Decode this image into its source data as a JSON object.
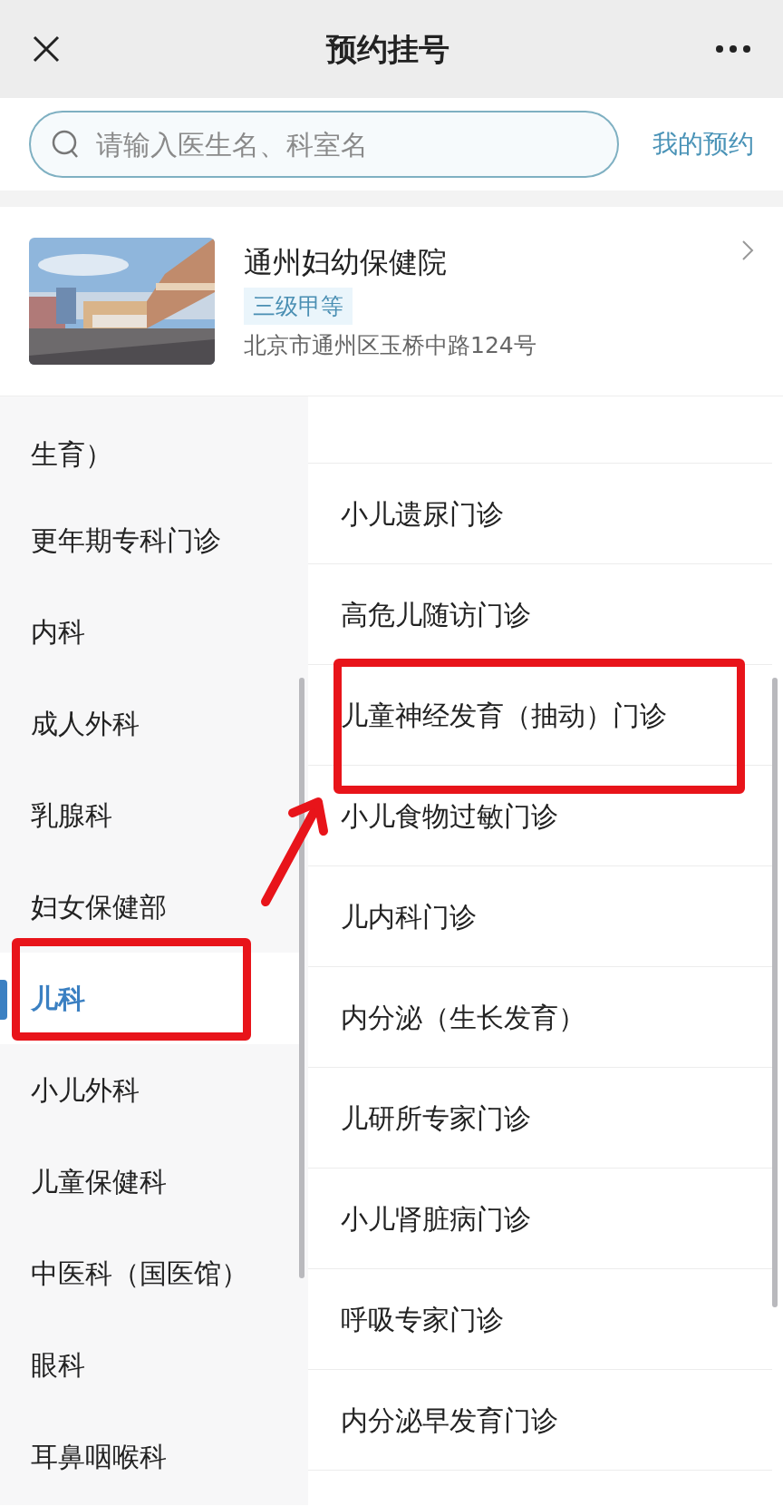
{
  "header": {
    "title": "预约挂号"
  },
  "search": {
    "placeholder": "请输入医生名、科室名",
    "link": "我的预约"
  },
  "hospital": {
    "name": "通州妇幼保健院",
    "badge": "三级甲等",
    "address": "北京市通州区玉桥中路124号"
  },
  "departments": [
    {
      "name": "生育）",
      "selected": false,
      "annotated": false,
      "partial": true
    },
    {
      "name": "更年期专科门诊",
      "selected": false,
      "annotated": false
    },
    {
      "name": "内科",
      "selected": false,
      "annotated": false
    },
    {
      "name": "成人外科",
      "selected": false,
      "annotated": false
    },
    {
      "name": "乳腺科",
      "selected": false,
      "annotated": false
    },
    {
      "name": "妇女保健部",
      "selected": false,
      "annotated": false
    },
    {
      "name": "儿科",
      "selected": true,
      "annotated": true
    },
    {
      "name": "小儿外科",
      "selected": false,
      "annotated": false
    },
    {
      "name": "儿童保健科",
      "selected": false,
      "annotated": false
    },
    {
      "name": "中医科（国医馆）",
      "selected": false,
      "annotated": false
    },
    {
      "name": "眼科",
      "selected": false,
      "annotated": false
    },
    {
      "name": "耳鼻咽喉科",
      "selected": false,
      "annotated": false
    }
  ],
  "clinics": [
    {
      "name": "小儿遗尿门诊",
      "annotated": false
    },
    {
      "name": "高危儿随访门诊",
      "annotated": false
    },
    {
      "name": "儿童神经发育（抽动）门诊",
      "annotated": true
    },
    {
      "name": "小儿食物过敏门诊",
      "annotated": false
    },
    {
      "name": "儿内科门诊",
      "annotated": false
    },
    {
      "name": "内分泌（生长发育）",
      "annotated": false
    },
    {
      "name": "儿研所专家门诊",
      "annotated": false
    },
    {
      "name": "小儿肾脏病门诊",
      "annotated": false
    },
    {
      "name": "呼吸专家门诊",
      "annotated": false
    },
    {
      "name": "内分泌早发育门诊",
      "annotated": false
    }
  ]
}
